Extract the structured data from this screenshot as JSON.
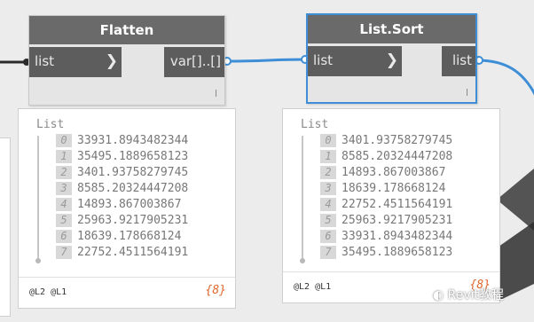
{
  "colors": {
    "wire_blue": "#3d8ed6",
    "wire_dark": "#2b2b2b",
    "node_header": "#6a6a6a",
    "port_bg": "#5d5d5d",
    "count_orange": "#e0682d"
  },
  "flatten": {
    "title": "Flatten",
    "input_label": "list",
    "output_label": "var[]..[]",
    "lacing": "l"
  },
  "sort": {
    "title": "List.Sort",
    "input_label": "list",
    "output_label": "list",
    "lacing": "l"
  },
  "flatten_preview": {
    "title": "List",
    "items": [
      {
        "index": "0",
        "value": "33931.8943482344"
      },
      {
        "index": "1",
        "value": "35495.1889658123"
      },
      {
        "index": "2",
        "value": "3401.93758279745"
      },
      {
        "index": "3",
        "value": "8585.20324447208"
      },
      {
        "index": "4",
        "value": "14893.867003867"
      },
      {
        "index": "5",
        "value": "25963.9217905231"
      },
      {
        "index": "6",
        "value": "18639.178668124"
      },
      {
        "index": "7",
        "value": "22752.4511564191"
      }
    ],
    "levels": "@L2 @L1",
    "count": "{8}"
  },
  "sort_preview": {
    "title": "List",
    "items": [
      {
        "index": "0",
        "value": "3401.93758279745"
      },
      {
        "index": "1",
        "value": "8585.20324447208"
      },
      {
        "index": "2",
        "value": "14893.867003867"
      },
      {
        "index": "3",
        "value": "18639.178668124"
      },
      {
        "index": "4",
        "value": "22752.4511564191"
      },
      {
        "index": "5",
        "value": "25963.9217905231"
      },
      {
        "index": "6",
        "value": "33931.8943482344"
      },
      {
        "index": "7",
        "value": "35495.1889658123"
      }
    ],
    "levels": "@L2 @L1",
    "count": "{8}"
  },
  "watermark": {
    "text": "Revit教程",
    "icon": "wechat-icon"
  }
}
